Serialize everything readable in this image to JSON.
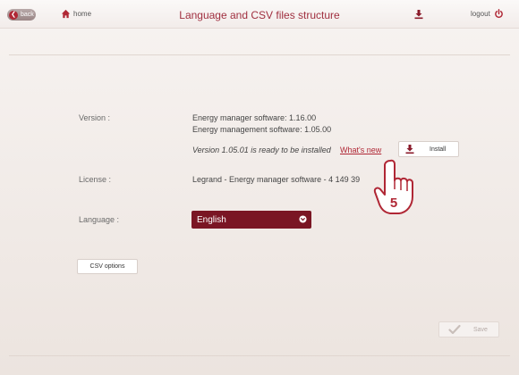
{
  "header": {
    "back_label": "back",
    "home_label": "home",
    "title": "Language and CSV files structure",
    "logout_label": "logout"
  },
  "version": {
    "label": "Version :",
    "energy_manager": "Energy manager software: 1.16.00",
    "energy_management": "Energy management software: 1.05.00",
    "update_notice": "Version 1.05.01 is ready to be installed",
    "whats_new": "What's new",
    "install_label": "Install"
  },
  "license": {
    "label": "License :",
    "value": "Legrand - Energy manager software - 4 149 39"
  },
  "language": {
    "label": "Language :",
    "selected": "English"
  },
  "csv_options_label": "CSV options",
  "save_label": "Save",
  "callout_number": "5",
  "colors": {
    "accent": "#b02735",
    "dark_red": "#7a1624",
    "background": "#f3ede9"
  }
}
